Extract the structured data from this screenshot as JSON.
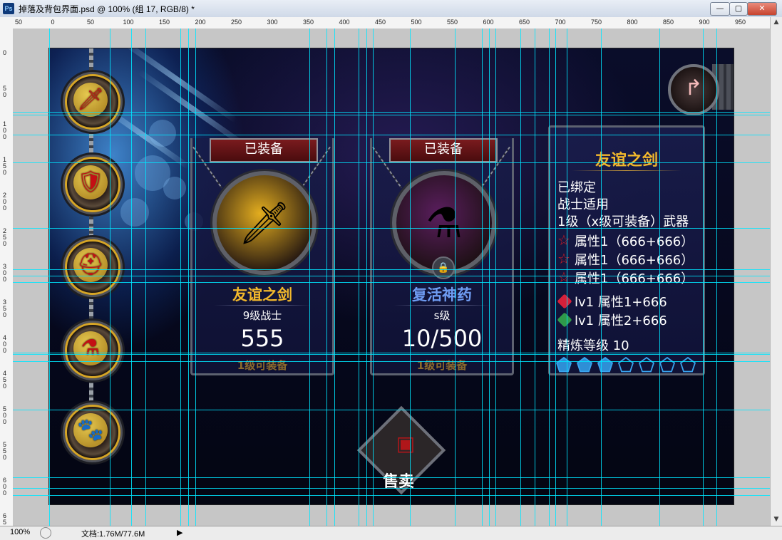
{
  "window": {
    "title": "掉落及背包界面.psd @ 100% (组 17, RGB/8) *",
    "app_icon_label": "Ps",
    "minimize": "—",
    "maximize": "▢",
    "close": "✕"
  },
  "rulers": {
    "horizontal_ticks": [
      "50",
      "0",
      "50",
      "100",
      "150",
      "200",
      "250",
      "300",
      "350",
      "400",
      "450",
      "500",
      "550",
      "600",
      "650",
      "700",
      "750",
      "800",
      "850",
      "900",
      "950"
    ],
    "vertical_ticks": [
      "0",
      "5 0",
      "1 0 0",
      "1 5 0",
      "2 0 0",
      "2 5 0",
      "3 0 0",
      "3 5 0",
      "4 0 0",
      "4 5 0",
      "5 0 0",
      "5 5 0",
      "6 0 0",
      "6 5"
    ]
  },
  "statusbar": {
    "zoom": "100%",
    "doc_info": "文档:1.76M/77.6M",
    "nav_arrow": "▶"
  },
  "game": {
    "side_slots": [
      {
        "name": "weapon-slot",
        "icon": "sword-icon",
        "glyph": "🗡"
      },
      {
        "name": "armor-slot",
        "icon": "armor-icon",
        "glyph": "🛡"
      },
      {
        "name": "helmet-slot",
        "icon": "helmet-icon",
        "glyph": "⛑"
      },
      {
        "name": "potion-slot",
        "icon": "potion-icon",
        "glyph": "⚗"
      },
      {
        "name": "pet-slot",
        "icon": "pet-icon",
        "glyph": "🐾"
      }
    ],
    "cards": [
      {
        "banner": "已装备",
        "name": "友谊之剑",
        "name_color": "#f2b82c",
        "sub": "9级战士",
        "number": "555",
        "req": "1级可装备",
        "orb_icon": "sword-icon",
        "orb_glyph": "🗡",
        "orb_color": "#e3ad1f"
      },
      {
        "banner": "已装备",
        "name": "复活神药",
        "name_color": "#6f9cf2",
        "sub": "s级",
        "number": "10/500",
        "req": "1级可装备",
        "orb_icon": "potion-icon",
        "orb_glyph": "⚗",
        "orb_color": "#5a1e5e"
      }
    ],
    "info_panel": {
      "title": "友谊之剑",
      "lines": [
        "已绑定",
        "战士适用",
        "1级（x级可装备）武器"
      ],
      "attributes": [
        "属性1（666+666）",
        "属性1（666+666）",
        "属性1（666+666）"
      ],
      "gems": [
        {
          "text": "lv1 属性1+666",
          "color": "#d6203a",
          "icon": "red-gem-icon"
        },
        {
          "text": "lv1 属性2+666",
          "color": "#2f9a4a",
          "icon": "green-gem-icon"
        }
      ],
      "refine": "精炼等级 10",
      "refine_filled": 3,
      "refine_total": 7
    },
    "sell_label": "售卖",
    "back_icon": "↱"
  }
}
